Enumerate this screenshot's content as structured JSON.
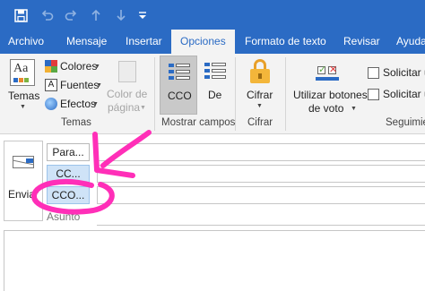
{
  "quick_access": {
    "save_icon": "save-icon",
    "undo_icon": "undo-icon",
    "redo_icon": "redo-icon",
    "up_icon": "up-arrow-icon",
    "down_icon": "down-arrow-icon",
    "customize_icon": "customize-icon"
  },
  "tabs": [
    {
      "label": "Archivo"
    },
    {
      "label": "Mensaje"
    },
    {
      "label": "Insertar"
    },
    {
      "label": "Opciones"
    },
    {
      "label": "Formato de texto"
    },
    {
      "label": "Revisar"
    },
    {
      "label": "Ayuda"
    }
  ],
  "ribbon": {
    "temas": {
      "temas_label": "Temas",
      "colores": "Colores",
      "fuentes": "Fuentes",
      "efectos": "Efectos",
      "color_pagina_1": "Color de",
      "color_pagina_2": "página",
      "group_label": "Temas"
    },
    "mostrar": {
      "cco": "CCO",
      "de": "De",
      "group_label": "Mostrar campos"
    },
    "cifrar": {
      "cifrar": "Cifrar",
      "group_label": "Cifrar"
    },
    "seguimiento": {
      "votar_1": "Utilizar botones",
      "votar_2": "de voto",
      "solicitar_1": "Solicitar u",
      "solicitar_2": "Solicitar u",
      "group_label": "Seguimie"
    }
  },
  "compose": {
    "send": "Enviar",
    "para": "Para...",
    "cc": "CC...",
    "cco": "CCO...",
    "asunto": "Asunto"
  },
  "colors": {
    "brand": "#2b6bc4",
    "annotation": "#ff2fb8"
  }
}
